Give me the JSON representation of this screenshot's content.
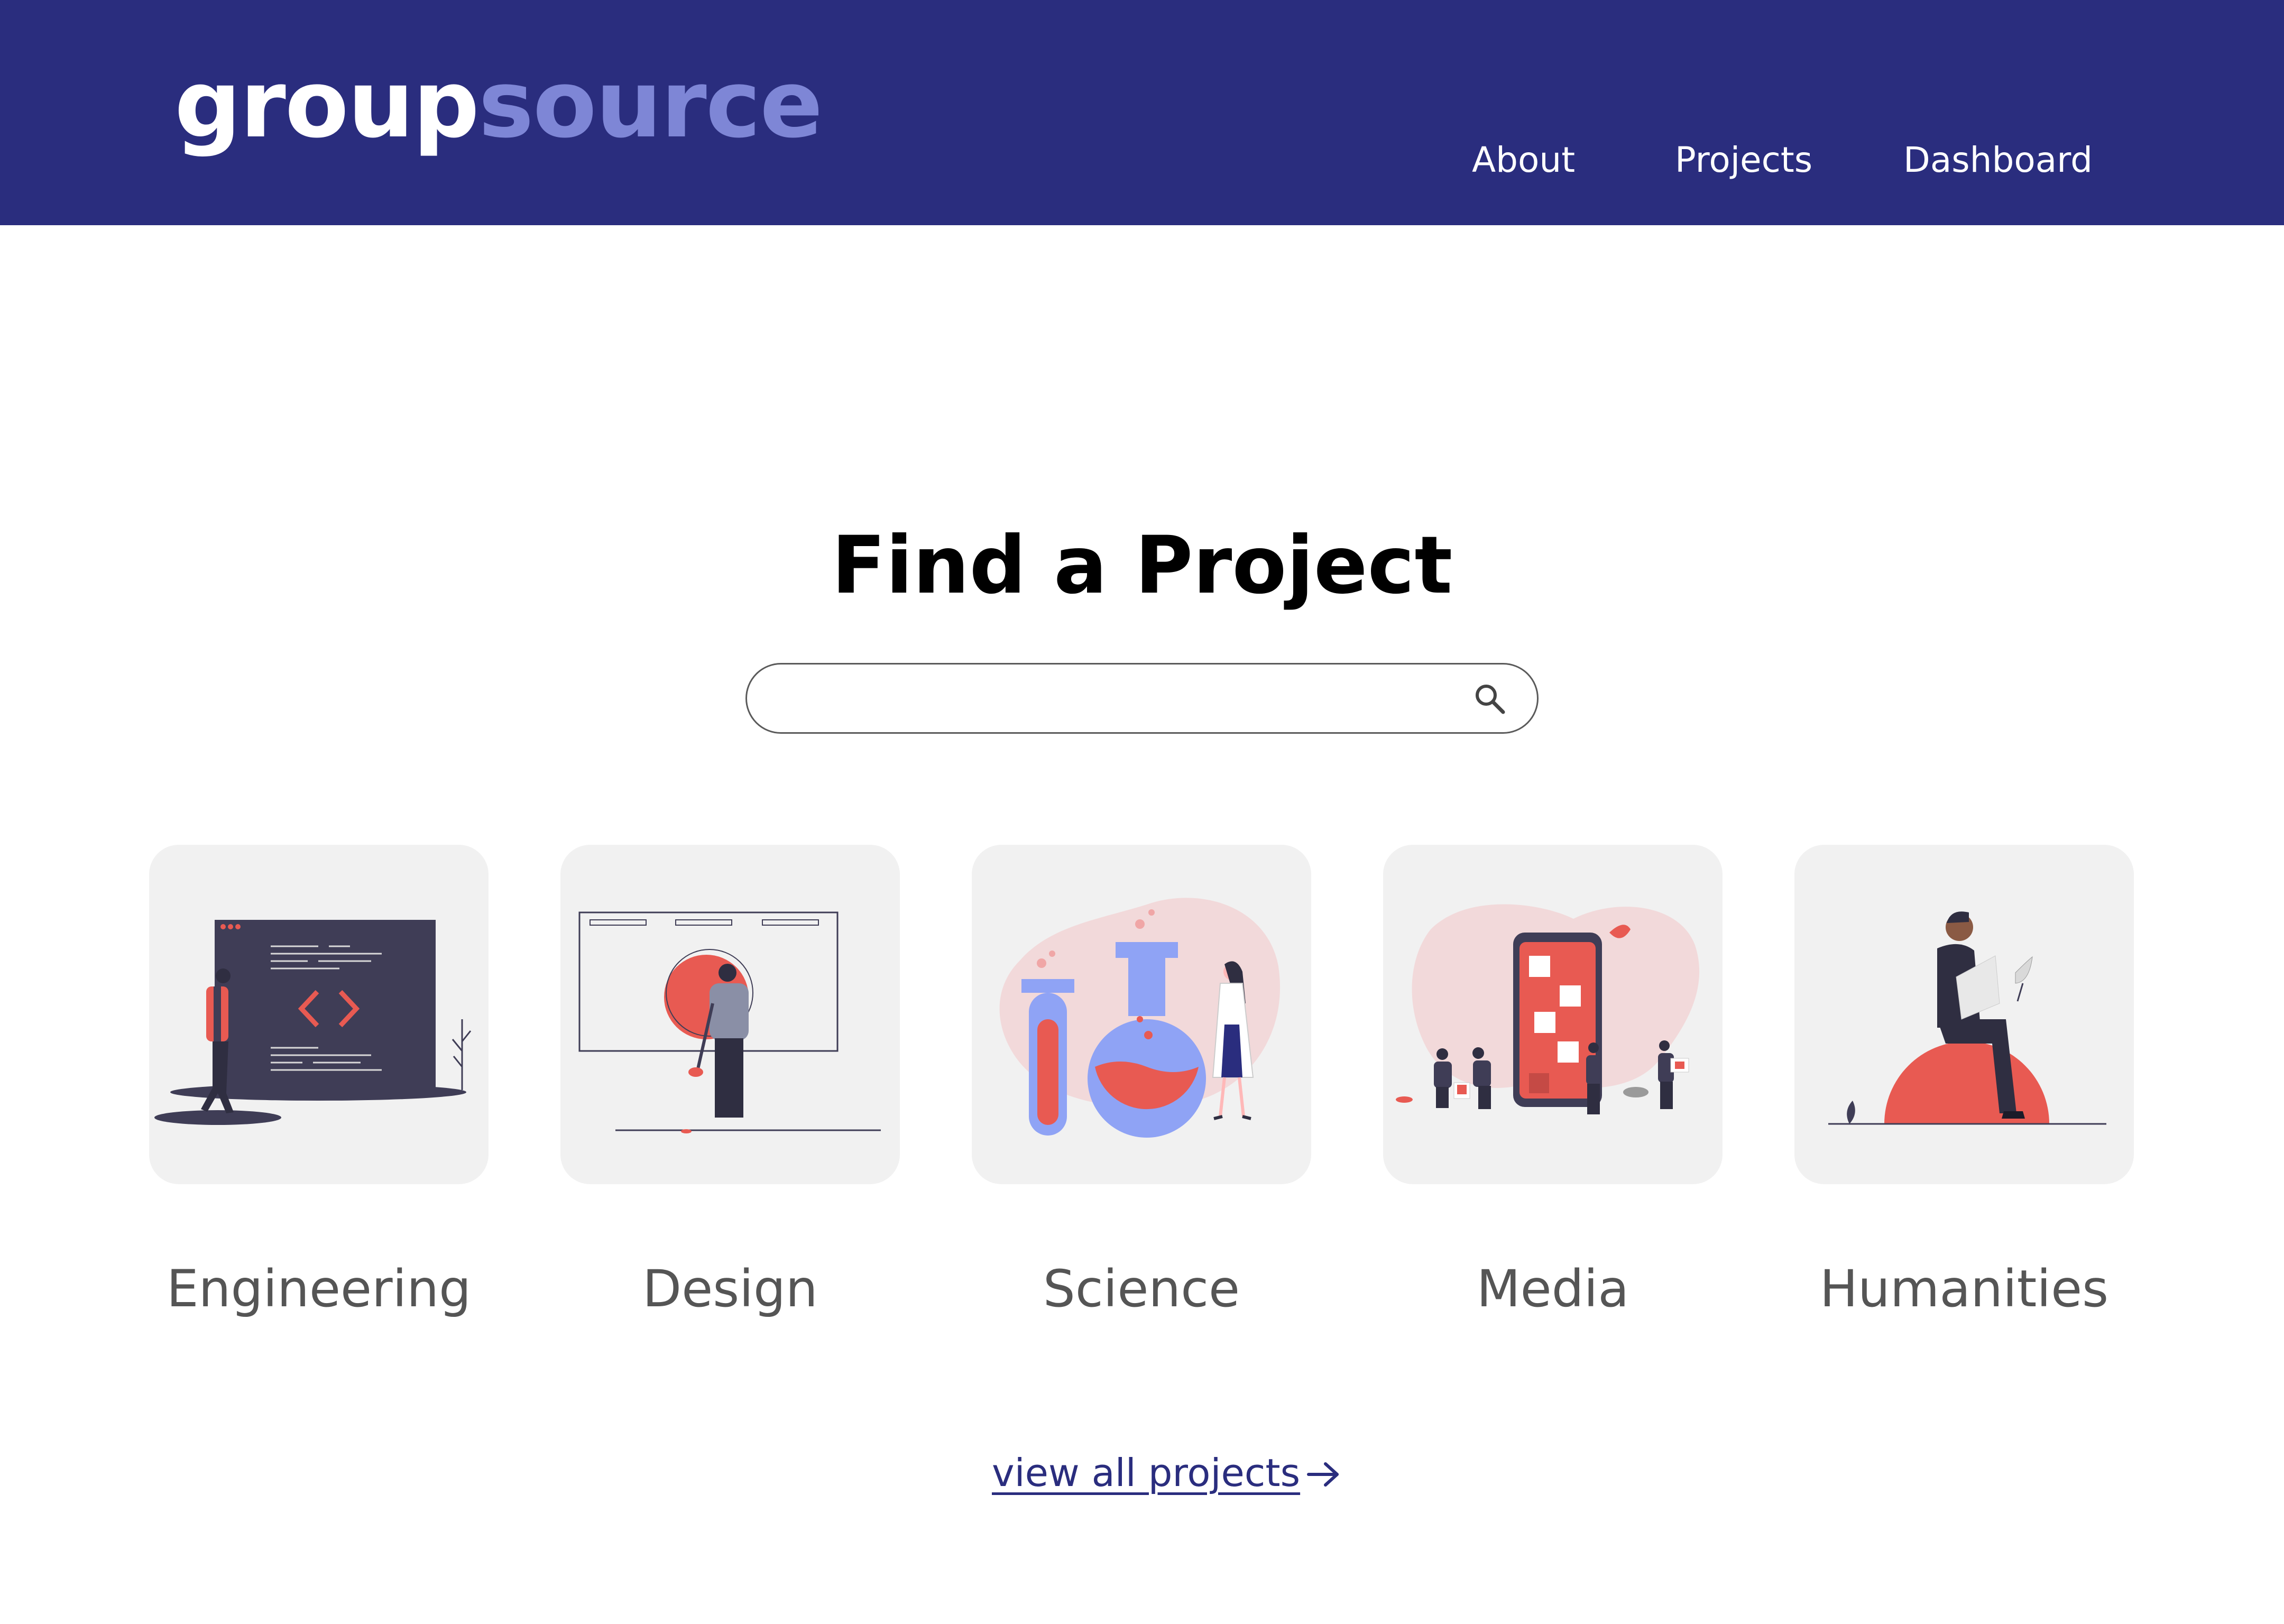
{
  "header": {
    "logo": {
      "part1": "group",
      "part2": "source"
    },
    "nav": [
      {
        "label": "About"
      },
      {
        "label": "Projects"
      },
      {
        "label": "Dashboard"
      }
    ]
  },
  "hero": {
    "title": "Find a Project",
    "search": {
      "value": "",
      "placeholder": "",
      "icon": "search-icon"
    }
  },
  "categories": [
    {
      "label": "Engineering",
      "icon": "code-window-illustration"
    },
    {
      "label": "Design",
      "icon": "painter-illustration"
    },
    {
      "label": "Science",
      "icon": "lab-flasks-illustration"
    },
    {
      "label": "Media",
      "icon": "social-phone-illustration"
    },
    {
      "label": "Humanities",
      "icon": "reader-illustration"
    }
  ],
  "view_all": {
    "label": "view all projects",
    "icon": "arrow-right-icon"
  },
  "colors": {
    "header_bg": "#2a2d7e",
    "logo_accent": "#7e86d6",
    "card_bg": "#f1f1f1",
    "illustration_red": "#e85a52",
    "illustration_dark": "#3f3d56",
    "illustration_blue": "#8fa3f5"
  }
}
